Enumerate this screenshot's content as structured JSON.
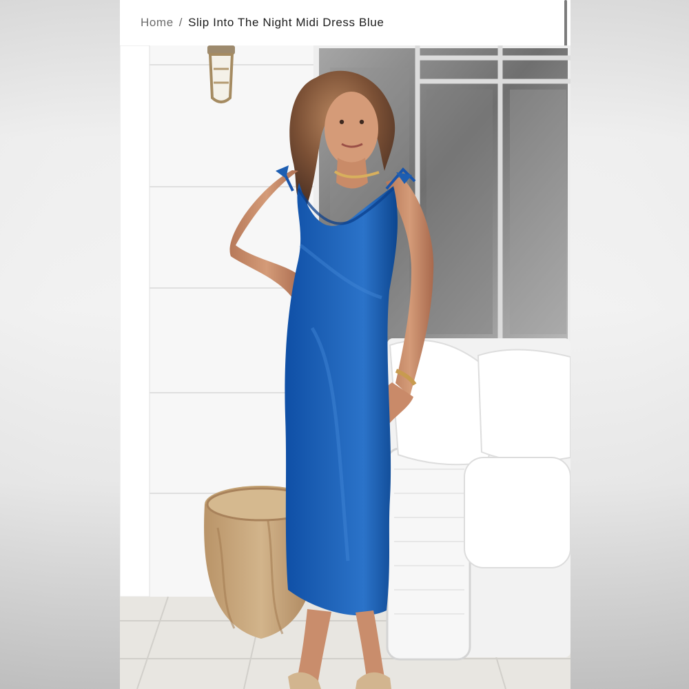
{
  "breadcrumb": {
    "home": "Home",
    "separator": "/",
    "current": "Slip Into The Night Midi Dress Blue"
  },
  "product": {
    "image_subject": "product-photo-model-blue-midi-dress",
    "dress_color": "#1f63b8",
    "accent_color": "#0f3f8d"
  }
}
